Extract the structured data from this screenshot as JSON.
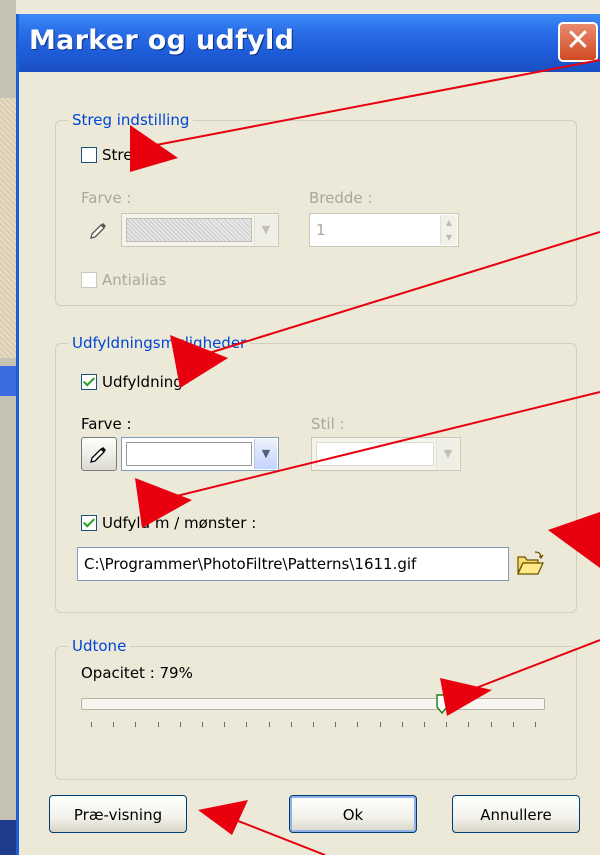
{
  "window": {
    "title": "Marker og udfyld",
    "close_symbol": "✕"
  },
  "stroke": {
    "legend": "Streg indstilling",
    "checkbox_label": "Streg",
    "checked": false,
    "color_label": "Farve :",
    "width_label": "Bredde :",
    "width_value": "1",
    "antialias_label": "Antialias"
  },
  "fill": {
    "legend": "Udfyldningsmuligheder",
    "checkbox_label": "Udfyldning",
    "checked": true,
    "color_label": "Farve :",
    "style_label": "Stil :",
    "pattern_label": "Udfyld m / mønster :",
    "pattern_checked": true,
    "pattern_path": "C:\\Programmer\\PhotoFiltre\\Patterns\\1611.gif"
  },
  "fade": {
    "legend": "Udtone",
    "opacity_label": "Opacitet : 79%",
    "opacity": 79
  },
  "buttons": {
    "preview": "Præ-visning",
    "ok": "Ok",
    "cancel": "Annullere"
  },
  "colors": {
    "title_bar": "#2a6ee8",
    "legend_text": "#0046d5",
    "annotation_arrow": "#e8000f"
  },
  "icons": [
    "close-icon",
    "eyedropper-icon",
    "folder-open-icon",
    "slider-thumb-icon",
    "arrow-annotation"
  ]
}
